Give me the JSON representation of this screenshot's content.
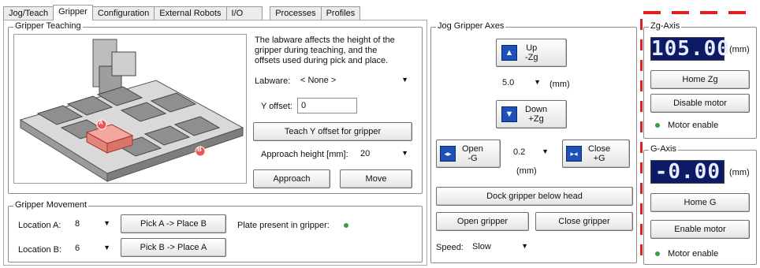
{
  "tabs": [
    "Jog/Teach",
    "Gripper",
    "Configuration",
    "External Robots",
    "I/O",
    "Processes",
    "Profiles"
  ],
  "teaching": {
    "legend": "Gripper Teaching",
    "description_lines": [
      "The labware affects the height of the",
      "gripper during teaching, and the",
      "offsets used during pick and place."
    ],
    "labware_label": "Labware:",
    "labware_value": "< None >",
    "y_offset_label": "Y offset:",
    "y_offset_value": "0",
    "teach_button": "Teach Y offset for gripper",
    "approach_height_label": "Approach height [mm]:",
    "approach_height_value": "20",
    "approach_button": "Approach",
    "move_button": "Move",
    "marker_a": "A",
    "marker_b": "B"
  },
  "movement": {
    "legend": "Gripper Movement",
    "location_a_label": "Location A:",
    "location_a_value": "8",
    "location_b_label": "Location B:",
    "location_b_value": "6",
    "pick_a_button": "Pick A -> Place B",
    "pick_b_button": "Pick B -> Place A",
    "plate_present_label": "Plate present in gripper:"
  },
  "jog": {
    "legend": "Jog Gripper Axes",
    "up_label_1": "Up",
    "up_label_2": "-Zg",
    "step_value": "5.0",
    "step_unit": "(mm)",
    "down_label_1": "Down",
    "down_label_2": "+Zg",
    "open_label_1": "Open",
    "open_label_2": "-G",
    "g_step_value": "0.2",
    "g_step_unit": "(mm)",
    "close_label_1": "Close",
    "close_label_2": "+G",
    "dock_button": "Dock gripper below head",
    "open_gripper_button": "Open gripper",
    "close_gripper_button": "Close gripper",
    "speed_label": "Speed:",
    "speed_value": "Slow"
  },
  "zg_axis": {
    "legend": "Zg-Axis",
    "readout": "105.00",
    "unit": "(mm)",
    "home_button": "Home Zg",
    "motor_button": "Disable motor",
    "motor_status": "Motor enable"
  },
  "g_axis": {
    "legend": "G-Axis",
    "readout": "-0.00",
    "unit": "(mm)",
    "home_button": "Home G",
    "motor_button": "Enable motor",
    "motor_status": "Motor enable"
  },
  "colors": {
    "lcd_bg": "#0d1a66",
    "status_green": "#3c9b45",
    "annotation_red": "#e02020",
    "arrow_blue": "#1f4fb8"
  }
}
